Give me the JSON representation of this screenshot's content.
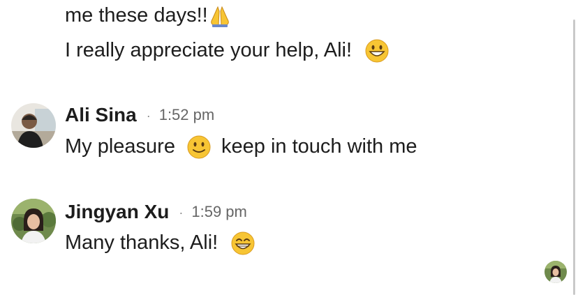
{
  "messages": {
    "earlier": {
      "line1": "me these days!!",
      "line1_emoji": "folded-hands-emoji",
      "line2": "I really appreciate your help, Ali!",
      "line2_emoji": "grinning-face-emoji"
    },
    "ali": {
      "author": "Ali Sina",
      "separator": "·",
      "time": "1:52 pm",
      "text_part1": "My pleasure",
      "emoji": "slightly-smiling-face-emoji",
      "text_part2": "keep in touch with me"
    },
    "jingyan": {
      "author": "Jingyan Xu",
      "separator": "·",
      "time": "1:59 pm",
      "text": "Many thanks, Ali!",
      "emoji": "beaming-face-emoji"
    }
  },
  "colors": {
    "text": "#1d1d1d",
    "meta": "#666666",
    "emoji_yellow": "#f7c534",
    "scrollbar": "#c9c9c9"
  }
}
